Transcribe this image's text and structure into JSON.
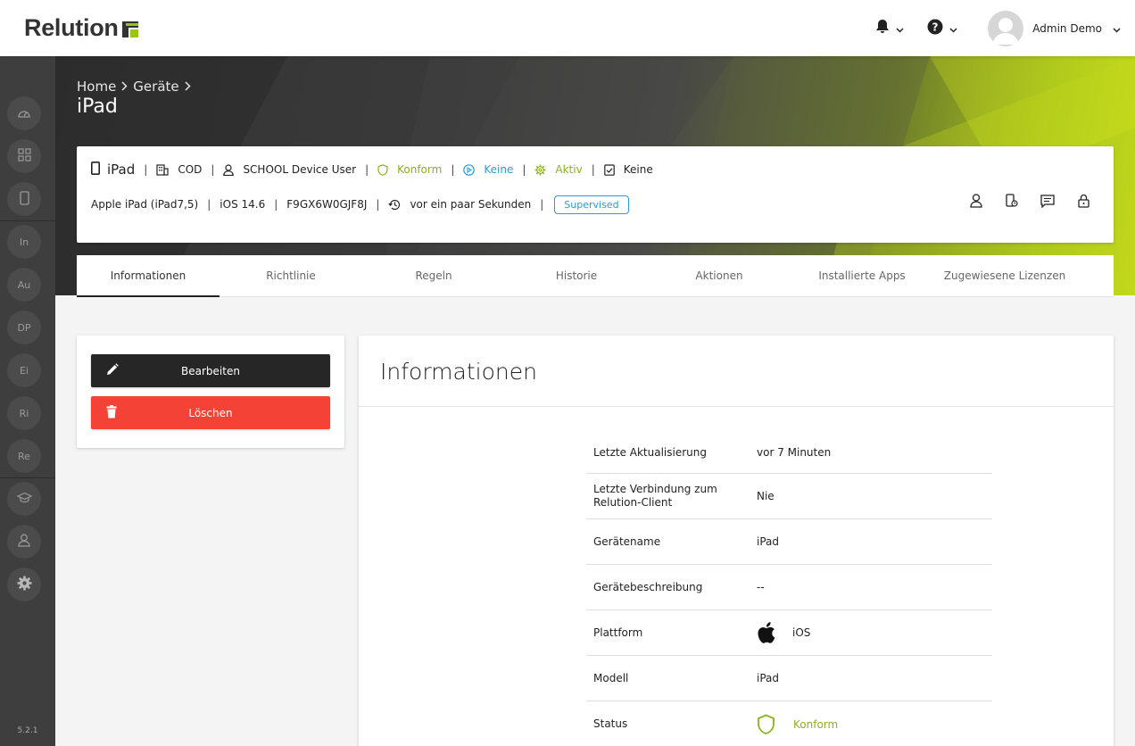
{
  "app": {
    "logo_text": "Relution"
  },
  "header": {
    "user_name": "Admin Demo"
  },
  "sidebar": {
    "text_items": [
      "In",
      "Au",
      "DP",
      "Ei",
      "Ri",
      "Re"
    ],
    "version": "5.2.1"
  },
  "breadcrumb": {
    "home": "Home",
    "devices": "Geräte",
    "separator": ">"
  },
  "page": {
    "title": "iPad"
  },
  "device": {
    "name": "iPad",
    "ownership": "COD",
    "user": "SCHOOL Device User",
    "compliance": "Konform",
    "policy": "Keine",
    "state": "Aktiv",
    "tasks": "Keine",
    "model": "Apple iPad (iPad7,5)",
    "os": "iOS 14.6",
    "serial": "F9GX6W0GJF8J",
    "last_seen": "vor ein paar Sekunden",
    "supervised_badge": "Supervised",
    "separator": "|"
  },
  "tabs": [
    {
      "label": "Informationen",
      "active": true
    },
    {
      "label": "Richtlinie"
    },
    {
      "label": "Regeln"
    },
    {
      "label": "Historie"
    },
    {
      "label": "Aktionen"
    },
    {
      "label": "Installierte Apps"
    },
    {
      "label": "Zugewiesene Lizenzen"
    }
  ],
  "actions": {
    "edit_label": "Bearbeiten",
    "delete_label": "Löschen"
  },
  "info": {
    "title": "Informationen",
    "rows": [
      {
        "label": "Letzte Aktualisierung",
        "value": "vor 7 Minuten"
      },
      {
        "label": "Letzte Verbindung zum Relution-Client",
        "value": "Nie"
      },
      {
        "label": "Gerätename",
        "value": "iPad"
      },
      {
        "label": "Gerätebeschreibung",
        "value": "--"
      },
      {
        "label": "Plattform",
        "value": "iOS"
      },
      {
        "label": "Modell",
        "value": "iPad"
      },
      {
        "label": "Status",
        "value": "Konform"
      }
    ]
  },
  "colors": {
    "accent_green": "#8bb31d",
    "accent_blue": "#2e9bd6",
    "delete_red": "#f44336",
    "edit_dark": "#262626",
    "sidebar_bg": "#3e3e3e"
  }
}
